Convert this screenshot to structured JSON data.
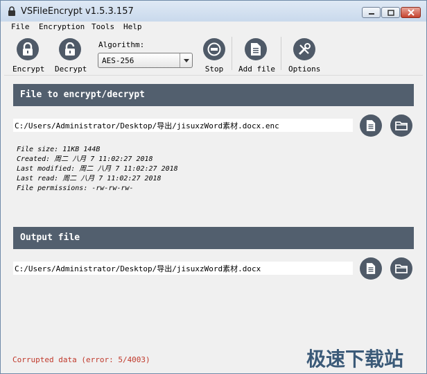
{
  "window": {
    "title": "VSFileEncrypt v1.5.3.157"
  },
  "menu": [
    "File",
    "Encryption",
    "Tools",
    "Help"
  ],
  "toolbar": {
    "encrypt_label": "Encrypt",
    "decrypt_label": "Decrypt",
    "algorithm_label": "Algorithm:",
    "algorithm_value": "AES-256",
    "stop_label": "Stop",
    "add_file_label": "Add file",
    "options_label": "Options"
  },
  "input_section": {
    "header": "File to encrypt/decrypt",
    "path": "C:/Users/Administrator/Desktop/导出/jisuxzWord素材.docx.enc",
    "info": [
      "File size: 11KB 144B",
      "Created: 周二 八月 7 11:02:27 2018",
      "Last modified: 周二 八月 7 11:02:27 2018",
      "Last read: 周二 八月 7 11:02:27 2018",
      "File permissions: -rw-rw-rw-"
    ]
  },
  "output_section": {
    "header": "Output file",
    "path": "C:/Users/Administrator/Desktop/导出/jisuxzWord素材.docx"
  },
  "status": {
    "text": "Corrupted data (error: 5/4003)",
    "color": "#c0392b"
  },
  "watermark": "极速下载站",
  "colors": {
    "icon_bg": "#4f5a68",
    "header_bg": "#525f6e"
  }
}
